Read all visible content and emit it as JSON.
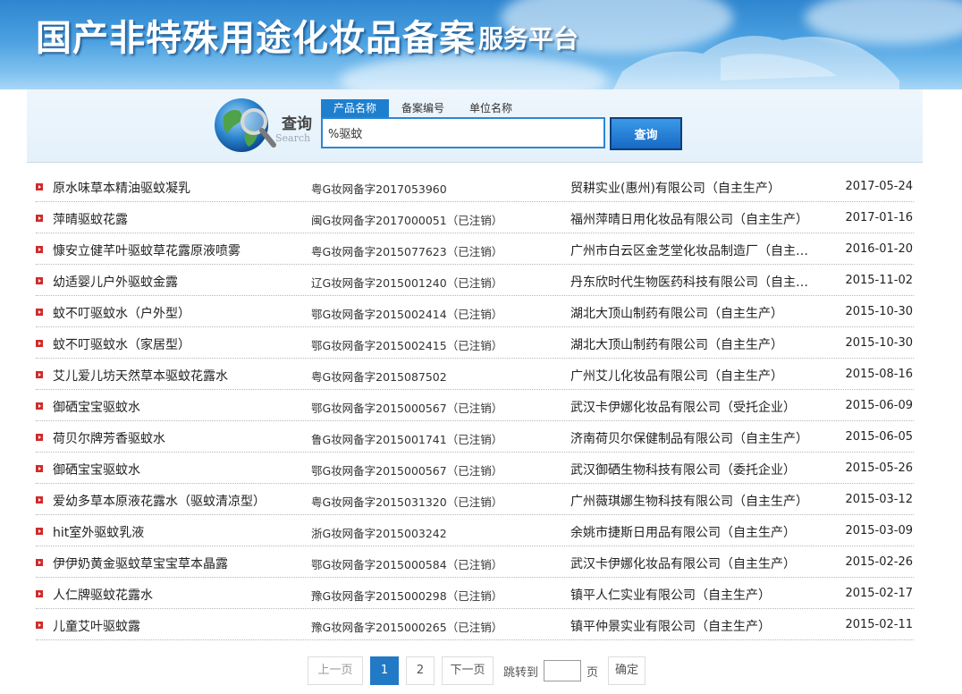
{
  "banner": {
    "title": "国产非特殊用途化妆品备案",
    "subtitle": "服务平台"
  },
  "search": {
    "label": "查询",
    "label_en": "Search",
    "tabs": [
      {
        "label": "产品名称",
        "active": true
      },
      {
        "label": "备案编号",
        "active": false
      },
      {
        "label": "单位名称",
        "active": false
      }
    ],
    "input_value": "%驱蚊",
    "button_label": "查询"
  },
  "results": [
    {
      "name": "原水味草本精油驱蚊凝乳",
      "record_no": "粤G妆网备字2017053960",
      "company": "贸耕实业(惠州)有限公司（自主生产）",
      "date": "2017-05-24"
    },
    {
      "name": "萍晴驱蚊花露",
      "record_no": "闽G妆网备字2017000051（已注销）",
      "company": "福州萍晴日用化妆品有限公司（自主生产）",
      "date": "2017-01-16"
    },
    {
      "name": "慷安立健芊叶驱蚊草花露原液喷雾",
      "record_no": "粤G妆网备字2015077623（已注销）",
      "company": "广州市白云区金芝堂化妆品制造厂（自主…",
      "date": "2016-01-20"
    },
    {
      "name": "幼适婴儿户外驱蚊金露",
      "record_no": "辽G妆网备字2015001240（已注销）",
      "company": "丹东欣时代生物医药科技有限公司（自主…",
      "date": "2015-11-02"
    },
    {
      "name": "蚊不叮驱蚊水（户外型）",
      "record_no": "鄂G妆网备字2015002414（已注销）",
      "company": "湖北大顶山制药有限公司（自主生产）",
      "date": "2015-10-30"
    },
    {
      "name": "蚊不叮驱蚊水（家居型）",
      "record_no": "鄂G妆网备字2015002415（已注销）",
      "company": "湖北大顶山制药有限公司（自主生产）",
      "date": "2015-10-30"
    },
    {
      "name": "艾儿爱儿坊天然草本驱蚊花露水",
      "record_no": "粤G妆网备字2015087502",
      "company": "广州艾儿化妆品有限公司（自主生产）",
      "date": "2015-08-16"
    },
    {
      "name": "御硒宝宝驱蚊水",
      "record_no": "鄂G妆网备字2015000567（已注销）",
      "company": "武汉卡伊娜化妆品有限公司（受托企业）",
      "date": "2015-06-09"
    },
    {
      "name": "荷贝尔牌芳香驱蚊水",
      "record_no": "鲁G妆网备字2015001741（已注销）",
      "company": "济南荷贝尔保健制品有限公司（自主生产）",
      "date": "2015-06-05"
    },
    {
      "name": "御硒宝宝驱蚊水",
      "record_no": "鄂G妆网备字2015000567（已注销）",
      "company": "武汉御硒生物科技有限公司（委托企业）",
      "date": "2015-05-26"
    },
    {
      "name": "爱幼多草本原液花露水（驱蚊清凉型）",
      "record_no": "粤G妆网备字2015031320（已注销）",
      "company": "广州薇琪娜生物科技有限公司（自主生产）",
      "date": "2015-03-12"
    },
    {
      "name": "hit室外驱蚊乳液",
      "record_no": "浙G妆网备字2015003242",
      "company": "余姚市捷斯日用品有限公司（自主生产）",
      "date": "2015-03-09"
    },
    {
      "name": "伊伊奶黄金驱蚊草宝宝草本晶露",
      "record_no": "鄂G妆网备字2015000584（已注销）",
      "company": "武汉卡伊娜化妆品有限公司（自主生产）",
      "date": "2015-02-26"
    },
    {
      "name": "人仁牌驱蚊花露水",
      "record_no": "豫G妆网备字2015000298（已注销）",
      "company": "镇平人仁实业有限公司（自主生产）",
      "date": "2015-02-17"
    },
    {
      "name": "儿童艾叶驱蚊露",
      "record_no": "豫G妆网备字2015000265（已注销）",
      "company": "镇平仲景实业有限公司（自主生产）",
      "date": "2015-02-11"
    }
  ],
  "pager": {
    "prev": "上一页",
    "pages": [
      "1",
      "2"
    ],
    "current": "1",
    "next": "下一页",
    "jump_label": "跳转到",
    "page_unit": "页",
    "confirm": "确定"
  },
  "colors": {
    "accent": "#2279c5",
    "bullet": "#d12a2a",
    "banner_top": "#2f86d0"
  }
}
